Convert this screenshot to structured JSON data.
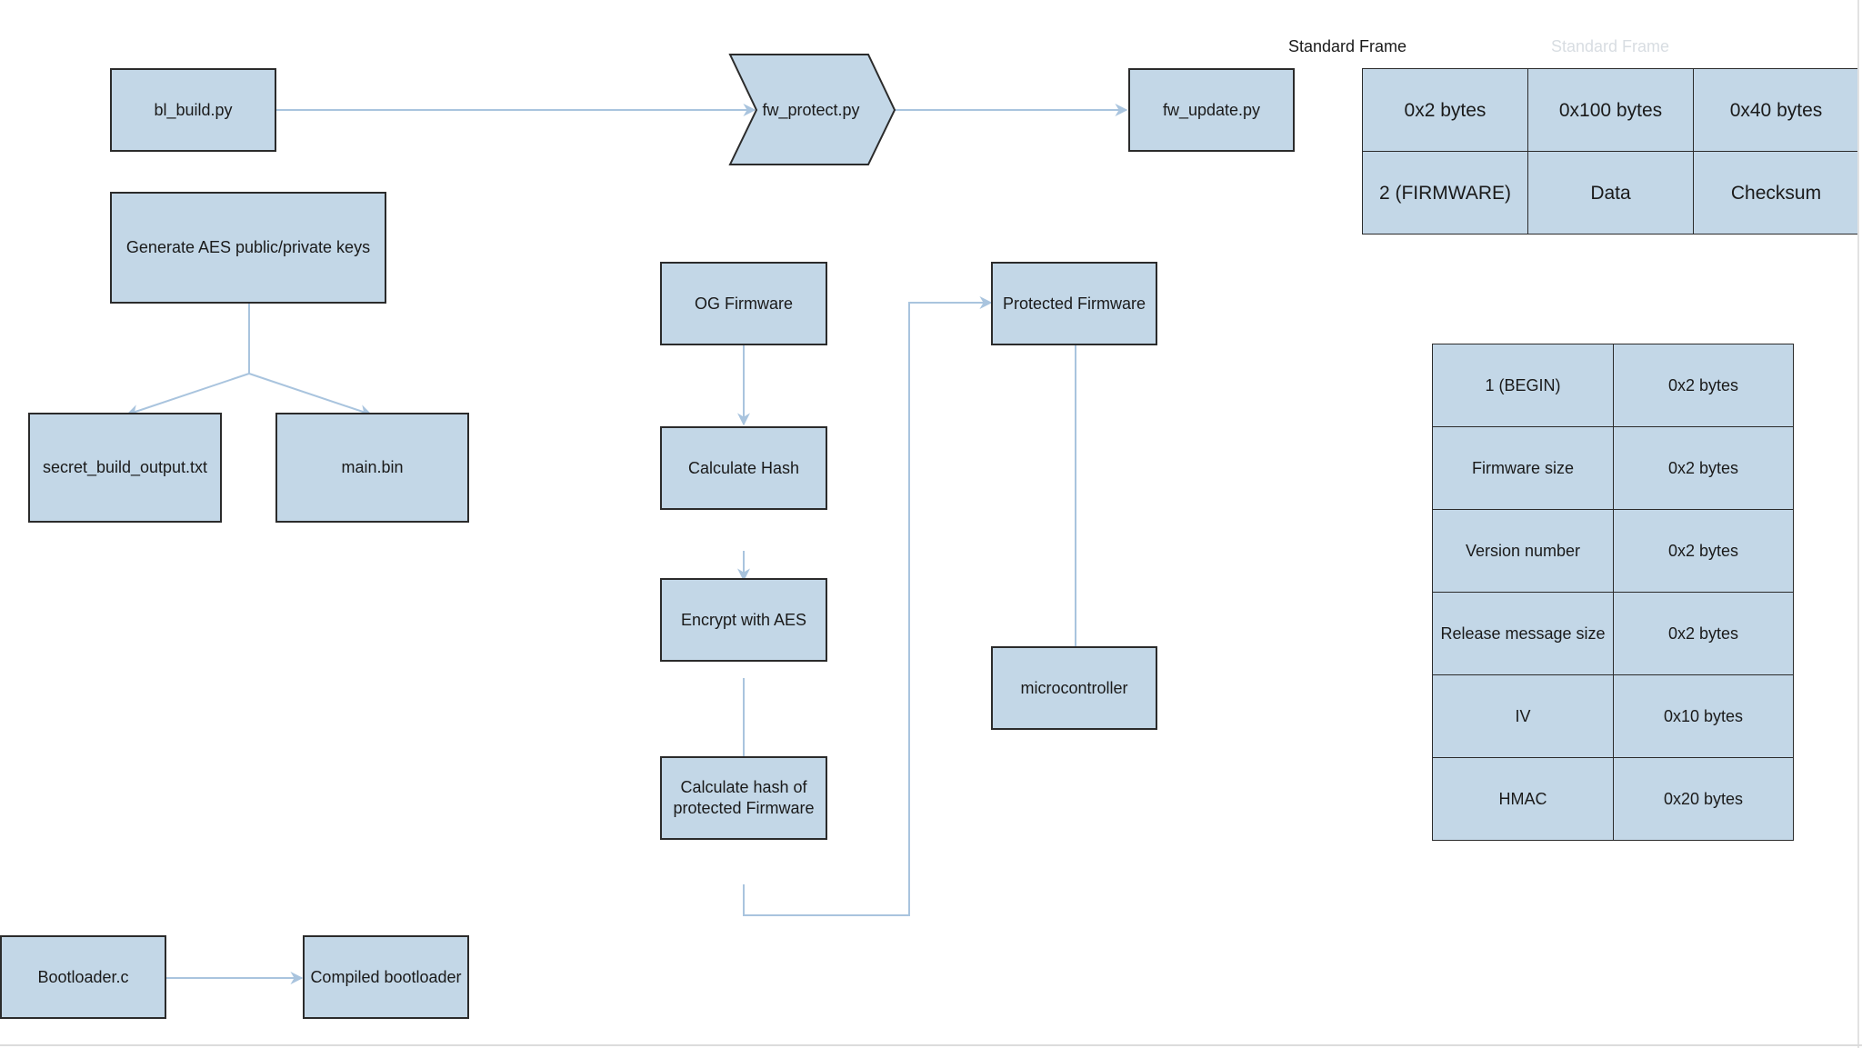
{
  "diagram": {
    "colors": {
      "node_fill": "#c3d7e7",
      "node_border": "#2b2b2b",
      "connector": "#a9c4de",
      "text": "#1a1a1a"
    },
    "nodes": {
      "bl_build": "bl_build.py",
      "fw_protect": "fw_protect.py",
      "fw_update": "fw_update.py",
      "generate_keys": "Generate AES public/private keys",
      "secret_output": "secret_build_output.txt",
      "main_bin": "main.bin",
      "og_firmware": "OG Firmware",
      "calculate_hash": "Calculate Hash",
      "encrypt_aes": "Encrypt with AES",
      "calculate_hash_protected": "Calculate hash of protected Firmware",
      "protected_firmware": "Protected Firmware",
      "microcontroller": "microcontroller",
      "bootloader_c": "Bootloader.c",
      "compiled_bootloader": "Compiled bootloader"
    },
    "edges": [
      {
        "from": "bl_build",
        "to": "fw_protect"
      },
      {
        "from": "fw_protect",
        "to": "fw_update"
      },
      {
        "from": "generate_keys",
        "to": "secret_output"
      },
      {
        "from": "generate_keys",
        "to": "main_bin"
      },
      {
        "from": "og_firmware",
        "to": "calculate_hash"
      },
      {
        "from": "calculate_hash",
        "to": "encrypt_aes"
      },
      {
        "from": "encrypt_aes",
        "to": "calculate_hash_protected"
      },
      {
        "from": "calculate_hash_protected",
        "to": "protected_firmware"
      },
      {
        "from": "protected_firmware",
        "to": "microcontroller"
      },
      {
        "from": "bootloader_c",
        "to": "compiled_bootloader"
      }
    ],
    "standard_frame": {
      "title": "Standard Frame",
      "ghost_title": "Standard Frame",
      "sizes": [
        "0x2 bytes",
        "0x100 bytes",
        "0x40 bytes"
      ],
      "fields": [
        "2 (FIRMWARE)",
        "Data",
        "Checksum"
      ]
    },
    "begin_frame": {
      "rows": [
        {
          "field": "1 (BEGIN)",
          "size": "0x2 bytes"
        },
        {
          "field": "Firmware size",
          "size": "0x2 bytes"
        },
        {
          "field": "Version number",
          "size": "0x2 bytes"
        },
        {
          "field": "Release message size",
          "size": "0x2 bytes"
        },
        {
          "field": "IV",
          "size": "0x10 bytes"
        },
        {
          "field": "HMAC",
          "size": "0x20 bytes"
        }
      ]
    }
  }
}
